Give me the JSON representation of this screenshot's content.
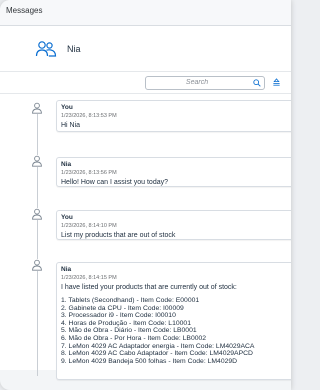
{
  "window": {
    "title": "Messages"
  },
  "participant": {
    "name": "Nia"
  },
  "search": {
    "placeholder": "Search"
  },
  "messages": [
    {
      "author": "You",
      "time": "1/23/2026, 8:13:53 PM",
      "text": "Hi Nia"
    },
    {
      "author": "Nia",
      "time": "1/23/2026, 8:13:56 PM",
      "text": "Hello! How can I assist you today?"
    },
    {
      "author": "You",
      "time": "1/23/2026, 8:14:10 PM",
      "text": "List my products that are out of stock"
    },
    {
      "author": "Nia",
      "time": "1/23/2026, 8:14:15 PM",
      "text": "I have listed your products that are currently out of stock:",
      "items": [
        "1. Tablets (Secondhand) - Item Code: E00001",
        "2. Gabinete da CPU - Item Code: I00009",
        "3. Processador i9 - Item Code: I00010",
        "4. Horas de Produção - Item Code: L10001",
        "5. Mão de Obra - Diário - Item Code: LB0001",
        "6. Mão de Obra - Por Hora - Item Code: LB0002",
        "7. LeMon 4029 AC Adaptador energia - Item Code: LM4029ACA",
        "8. LeMon 4029 AC Cabo Adaptador - Item Code: LM4029APCD",
        "9. LeMon 4029 Bandeja 500 folhas - Item Code: LM4029D"
      ]
    }
  ],
  "icons": {
    "participants": "people-group-icon",
    "search": "search-icon",
    "sort": "sort-icon",
    "avatar": "person-icon"
  },
  "colors": {
    "accent": "#0a6ed1",
    "timeline": "#c9ced4",
    "text": "#1d2d3e",
    "muted": "#6a6d70"
  }
}
